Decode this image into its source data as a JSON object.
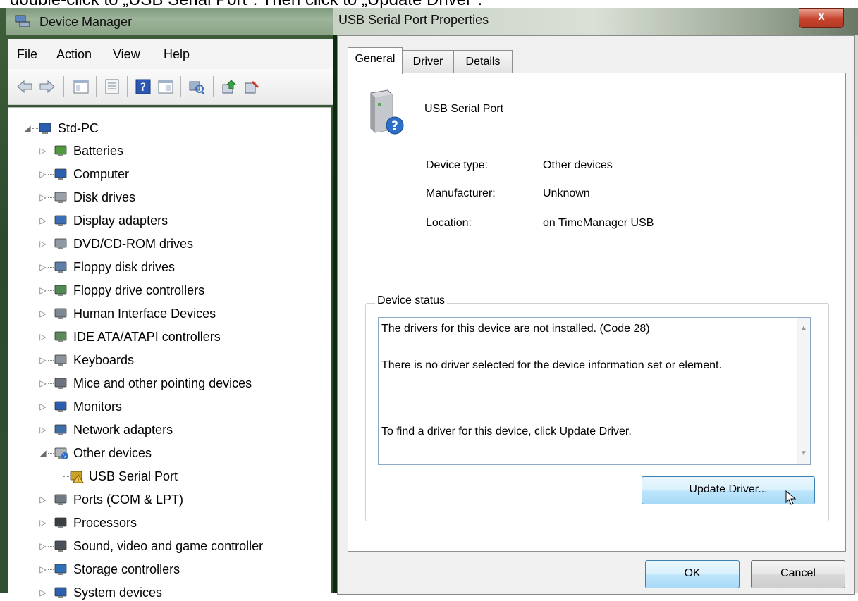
{
  "caption": "double-click to „USB Serial Port\". Then click to „Update Driver\".",
  "device_manager": {
    "title": "Device Manager",
    "menu": [
      "File",
      "Action",
      "View",
      "Help"
    ],
    "toolbar_icons": [
      "back-arrow-icon",
      "forward-arrow-icon",
      "show-hide-console-tree-icon",
      "properties-icon",
      "help-icon",
      "action-pane-icon",
      "scan-hardware-icon",
      "update-driver-icon",
      "uninstall-icon"
    ],
    "tree": {
      "root": "Std-PC",
      "items": [
        {
          "label": "Batteries",
          "icon": "battery-icon"
        },
        {
          "label": "Computer",
          "icon": "computer-icon"
        },
        {
          "label": "Disk drives",
          "icon": "disk-drive-icon"
        },
        {
          "label": "Display adapters",
          "icon": "display-adapter-icon"
        },
        {
          "label": "DVD/CD-ROM drives",
          "icon": "dvd-drive-icon"
        },
        {
          "label": "Floppy disk drives",
          "icon": "floppy-drive-icon"
        },
        {
          "label": "Floppy drive controllers",
          "icon": "floppy-controller-icon"
        },
        {
          "label": "Human Interface Devices",
          "icon": "hid-icon"
        },
        {
          "label": "IDE ATA/ATAPI controllers",
          "icon": "ide-controller-icon"
        },
        {
          "label": "Keyboards",
          "icon": "keyboard-icon"
        },
        {
          "label": "Mice and other pointing devices",
          "icon": "mouse-icon"
        },
        {
          "label": "Monitors",
          "icon": "monitor-icon"
        },
        {
          "label": "Network adapters",
          "icon": "network-adapter-icon"
        },
        {
          "label": "Other devices",
          "icon": "unknown-device-icon",
          "expanded": true
        },
        {
          "label": "USB Serial Port",
          "icon": "warning-device-icon",
          "child": true
        },
        {
          "label": "Ports (COM & LPT)",
          "icon": "port-icon"
        },
        {
          "label": "Processors",
          "icon": "processor-icon"
        },
        {
          "label": "Sound, video and game controller",
          "icon": "speaker-icon"
        },
        {
          "label": "Storage controllers",
          "icon": "storage-controller-icon"
        },
        {
          "label": "System devices",
          "icon": "system-device-icon"
        }
      ]
    }
  },
  "dialog": {
    "title": "USB Serial Port Properties",
    "close_label": "X",
    "tabs": [
      "General",
      "Driver",
      "Details"
    ],
    "device_name": "USB Serial Port",
    "properties": [
      {
        "label": "Device type:",
        "value": "Other devices"
      },
      {
        "label": "Manufacturer:",
        "value": "Unknown"
      },
      {
        "label": "Location:",
        "value": "on TimeManager USB"
      }
    ],
    "status_group_label": "Device status",
    "status_lines": [
      "The drivers for this device are not installed. (Code 28)",
      "There is no driver selected for the device information set or element.",
      "To find a driver for this device, click Update Driver."
    ],
    "update_driver_label": "Update Driver...",
    "ok_label": "OK",
    "cancel_label": "Cancel"
  }
}
